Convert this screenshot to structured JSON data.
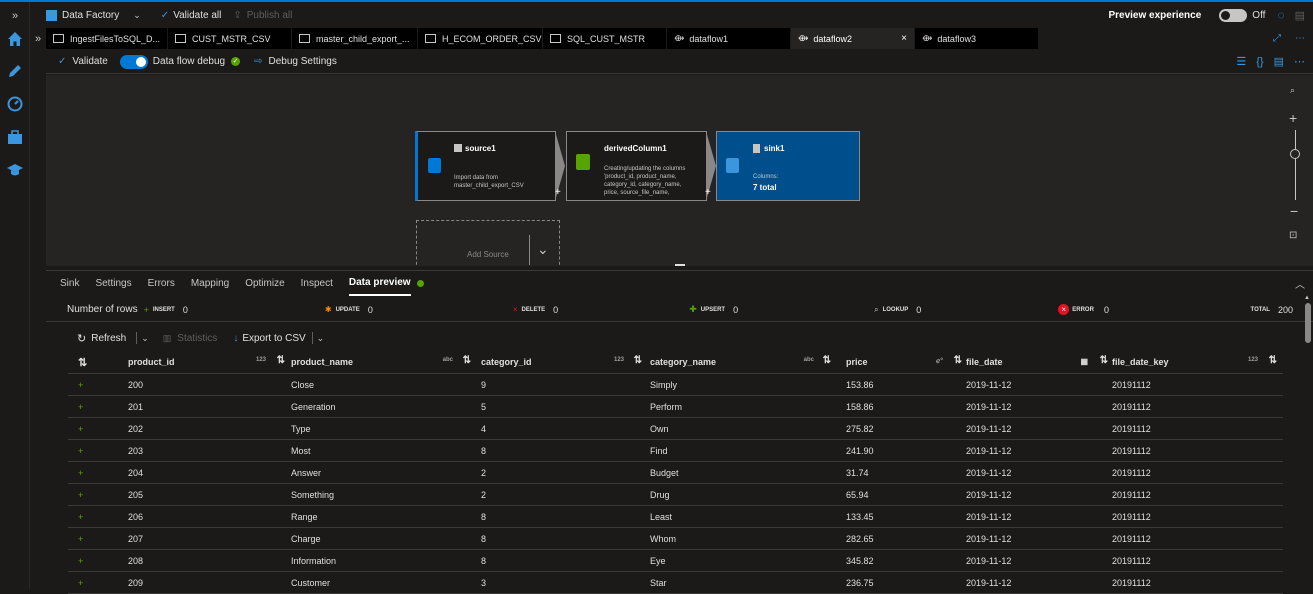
{
  "topbar": {
    "factory": "Data Factory",
    "validate_all": "Validate all",
    "publish_all": "Publish all",
    "preview_experience": "Preview experience",
    "toggle_state": "Off"
  },
  "tabs": [
    {
      "label": "IngestFilesToSQL_D..."
    },
    {
      "label": "CUST_MSTR_CSV"
    },
    {
      "label": "master_child_export_..."
    },
    {
      "label": "H_ECOM_ORDER_CSV"
    },
    {
      "label": "SQL_CUST_MSTR"
    },
    {
      "label": "dataflow1"
    },
    {
      "label": "dataflow2"
    },
    {
      "label": "dataflow3"
    }
  ],
  "toolbar": {
    "validate": "Validate",
    "debug": "Data flow debug",
    "debug_settings": "Debug Settings"
  },
  "canvas": {
    "source": {
      "title": "source1",
      "desc1": "Import data from",
      "desc2": "master_child_export_CSV"
    },
    "derived": {
      "title": "derivedColumn1",
      "desc1": "Creating/updating the columns",
      "desc2": "'product_id, product_name,",
      "desc3": "category_id, category_name,",
      "desc4": "price, source_file_name,"
    },
    "sink": {
      "title": "sink1",
      "cols_label": "Columns:",
      "cols_value": "7 total"
    },
    "add_source": "Add Source",
    "plus": "+"
  },
  "bottom_tabs": [
    "Sink",
    "Settings",
    "Errors",
    "Mapping",
    "Optimize",
    "Inspect",
    "Data preview"
  ],
  "rows": {
    "label": "Number of rows",
    "insert_label": "INSERT",
    "insert": "0",
    "update_label": "UPDATE",
    "update": "0",
    "delete_label": "DELETE",
    "delete": "0",
    "upsert_label": "UPSERT",
    "upsert": "0",
    "lookup_label": "LOOKUP",
    "lookup": "0",
    "error_label": "ERROR",
    "error": "0",
    "total_label": "TOTAL",
    "total": "200"
  },
  "preview_toolbar": {
    "refresh": "Refresh",
    "statistics": "Statistics",
    "export": "Export to CSV"
  },
  "table": {
    "columns": [
      {
        "name": "product_id",
        "type": "123"
      },
      {
        "name": "product_name",
        "type": "abc"
      },
      {
        "name": "category_id",
        "type": "123"
      },
      {
        "name": "category_name",
        "type": "abc"
      },
      {
        "name": "price",
        "type": "ℯ°"
      },
      {
        "name": "file_date",
        "type": "▦"
      },
      {
        "name": "file_date_key",
        "type": "123"
      }
    ],
    "rows": [
      [
        "200",
        "Close",
        "9",
        "Simply",
        "153.86",
        "2019-11-12",
        "20191112"
      ],
      [
        "201",
        "Generation",
        "5",
        "Perform",
        "158.86",
        "2019-11-12",
        "20191112"
      ],
      [
        "202",
        "Type",
        "4",
        "Own",
        "275.82",
        "2019-11-12",
        "20191112"
      ],
      [
        "203",
        "Most",
        "8",
        "Find",
        "241.90",
        "2019-11-12",
        "20191112"
      ],
      [
        "204",
        "Answer",
        "2",
        "Budget",
        "31.74",
        "2019-11-12",
        "20191112"
      ],
      [
        "205",
        "Something",
        "2",
        "Drug",
        "65.94",
        "2019-11-12",
        "20191112"
      ],
      [
        "206",
        "Range",
        "8",
        "Least",
        "133.45",
        "2019-11-12",
        "20191112"
      ],
      [
        "207",
        "Charge",
        "8",
        "Whom",
        "282.65",
        "2019-11-12",
        "20191112"
      ],
      [
        "208",
        "Information",
        "8",
        "Eye",
        "345.82",
        "2019-11-12",
        "20191112"
      ],
      [
        "209",
        "Customer",
        "3",
        "Star",
        "236.75",
        "2019-11-12",
        "20191112"
      ]
    ]
  },
  "colors": {
    "accent": "#0078d4",
    "insert": "#57a300",
    "error": "#e81123",
    "sink_bg": "#004e8c"
  }
}
